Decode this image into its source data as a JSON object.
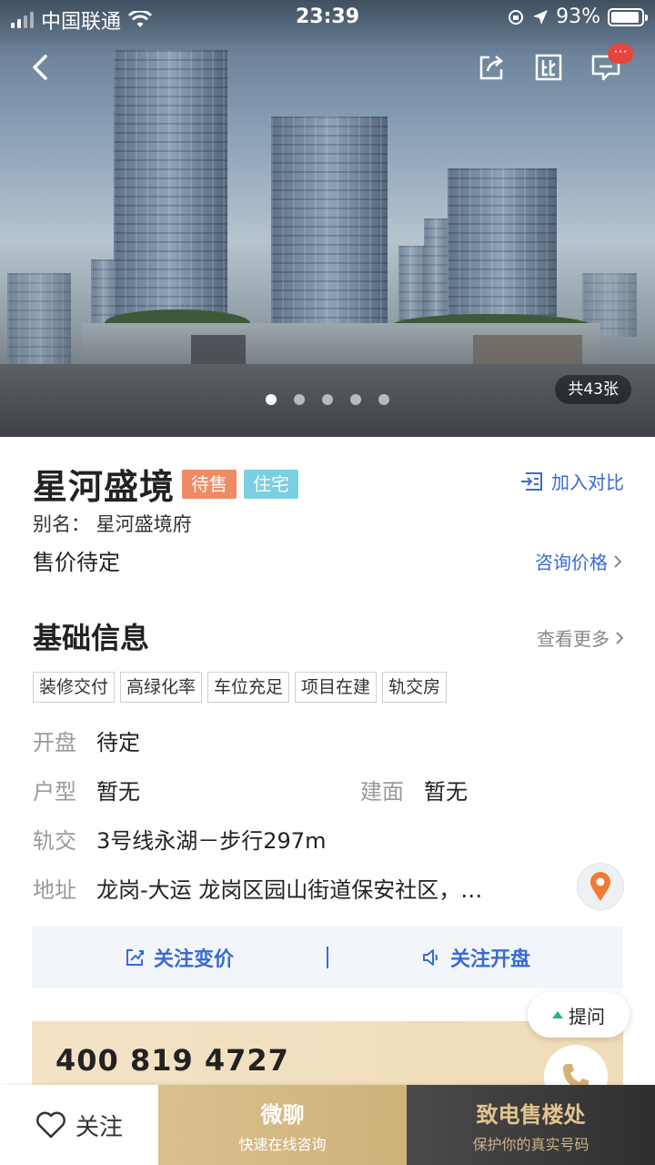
{
  "status_bar": {
    "carrier": "中国联通",
    "time": "23:39",
    "battery": "93%",
    "battery_level": 0.93
  },
  "nav": {
    "message_badge": "···"
  },
  "gallery": {
    "photo_count": "共43张",
    "total_dots": 5,
    "active_dot": 0
  },
  "project": {
    "name": "星河盛境",
    "status_tag": "待售",
    "type_tag": "住宅",
    "compare_label": "加入对比",
    "alias": "别名：  星河盛境府",
    "price": "售价待定",
    "consult_label": "咨询价格"
  },
  "basic_info": {
    "title": "基础信息",
    "see_more": "查看更多",
    "features": [
      "装修交付",
      "高绿化率",
      "车位充足",
      "项目在建",
      "轨交房"
    ],
    "opening_key": "开盘",
    "opening_value": "待定",
    "layout_key": "户型",
    "layout_value": "暂无",
    "area_key": "建面",
    "area_value": "暂无",
    "metro_key": "轨交",
    "metro_value": "3号线永湖－步行297m",
    "address_key": "地址",
    "address_value": "龙岗-大运 龙岗区园山街道保安社区，…"
  },
  "follow": {
    "price_change": "关注变价",
    "opening": "关注开盘"
  },
  "contact": {
    "phone": "400 819 4727",
    "ask_label": "提问"
  },
  "bottom_bar": {
    "follow_label": "关注",
    "chat_label": "微聊",
    "chat_sub": "快速在线咨询",
    "call_label": "致电售楼处",
    "call_sub": "保护你的真实号码"
  },
  "colors": {
    "accent_blue": "#3a6ad4",
    "tag_sale": "#ef8a66",
    "tag_type": "#7bcfe0",
    "gold": "#d9c08e",
    "badge_red": "#e8453c"
  }
}
